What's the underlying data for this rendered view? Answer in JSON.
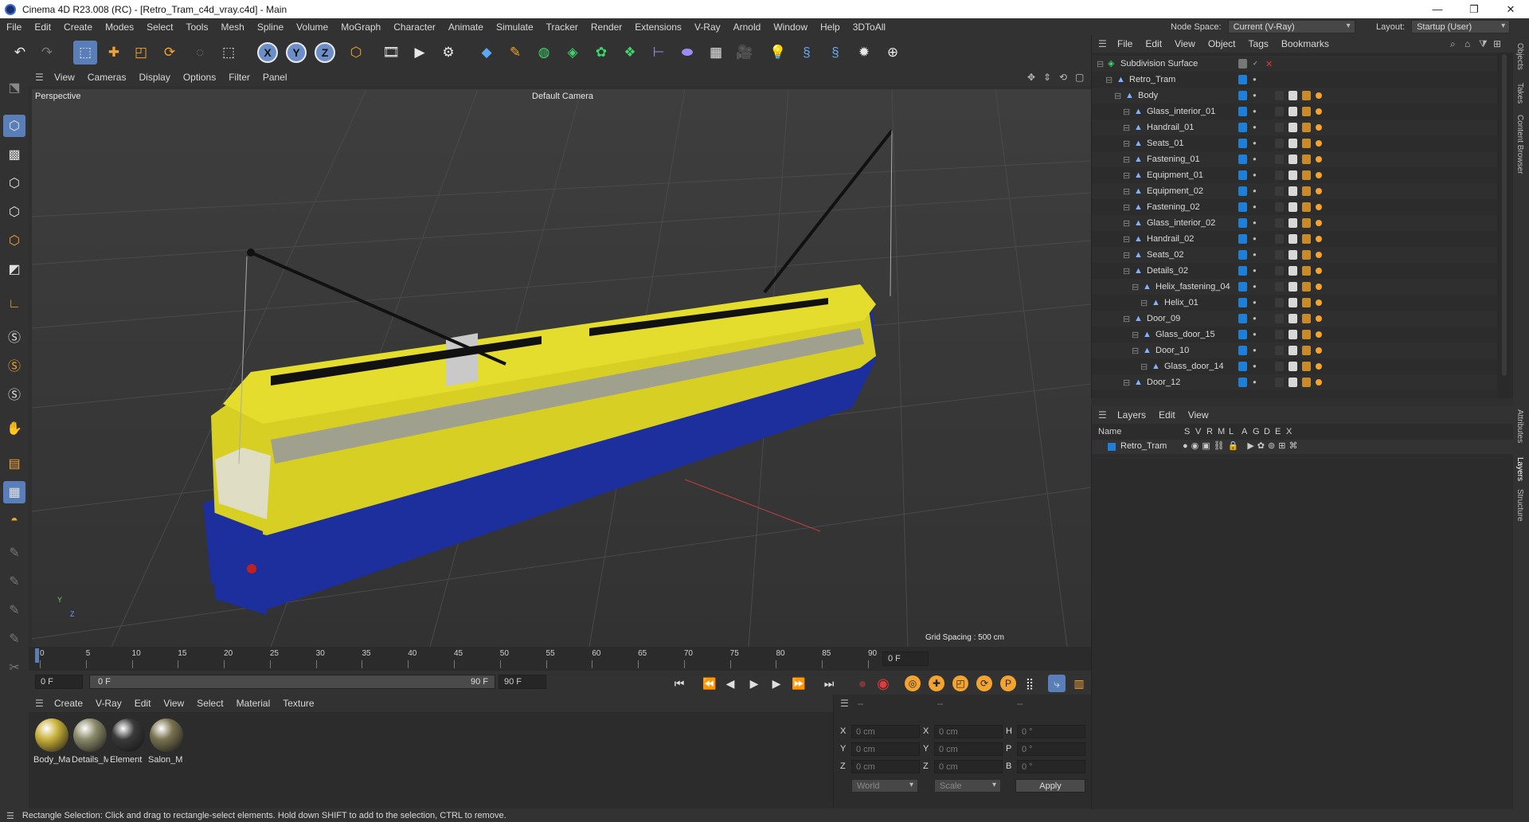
{
  "window": {
    "title": "Cinema 4D R23.008 (RC) - [Retro_Tram_c4d_vray.c4d] - Main",
    "minimize": "—",
    "maximize": "❐",
    "close": "✕"
  },
  "menubar": {
    "items": [
      "File",
      "Edit",
      "Create",
      "Modes",
      "Select",
      "Tools",
      "Mesh",
      "Spline",
      "Volume",
      "MoGraph",
      "Character",
      "Animate",
      "Simulate",
      "Tracker",
      "Render",
      "Extensions",
      "V-Ray",
      "Arnold",
      "Window",
      "Help",
      "3DToAll"
    ],
    "node_space_label": "Node Space:",
    "node_space_value": "Current (V-Ray)",
    "layout_label": "Layout:",
    "layout_value": "Startup (User)"
  },
  "toolbar": {
    "axis_x": "X",
    "axis_y": "Y",
    "axis_z": "Z"
  },
  "viewport": {
    "menu": [
      "View",
      "Cameras",
      "Display",
      "Options",
      "Filter",
      "Panel"
    ],
    "view_name": "Perspective",
    "camera_name": "Default Camera",
    "grid_spacing": "Grid Spacing : 500 cm",
    "axis_y": "Y",
    "axis_z": "Z"
  },
  "timeline": {
    "ticks": [
      "0",
      "5",
      "10",
      "15",
      "20",
      "25",
      "30",
      "35",
      "40",
      "45",
      "50",
      "55",
      "60",
      "65",
      "70",
      "75",
      "80",
      "85",
      "90"
    ],
    "current_frame": "0 F",
    "start_field": "0 F",
    "range_start": "0 F",
    "range_end": "90 F",
    "end_field": "90 F",
    "right_frame": "0 F"
  },
  "materials": {
    "menu": [
      "Create",
      "V-Ray",
      "Edit",
      "View",
      "Select",
      "Material",
      "Texture"
    ],
    "items": [
      {
        "label": "Body_Ma",
        "color": "#c9b13a"
      },
      {
        "label": "Details_M",
        "color": "#8a8a6a"
      },
      {
        "label": "Element",
        "color": "#3a3a3a"
      },
      {
        "label": "Salon_M",
        "color": "#7a7350"
      }
    ]
  },
  "coords": {
    "header_a": "--",
    "header_b": "--",
    "header_c": "--",
    "rows": [
      {
        "l1": "X",
        "v1": "0 cm",
        "l2": "X",
        "v2": "0 cm",
        "l3": "H",
        "v3": "0 °"
      },
      {
        "l1": "Y",
        "v1": "0 cm",
        "l2": "Y",
        "v2": "0 cm",
        "l3": "P",
        "v3": "0 °"
      },
      {
        "l1": "Z",
        "v1": "0 cm",
        "l2": "Z",
        "v2": "0 cm",
        "l3": "B",
        "v3": "0 °"
      }
    ],
    "mode_world": "World",
    "mode_scale": "Scale",
    "apply": "Apply"
  },
  "objects": {
    "menu": [
      "File",
      "Edit",
      "View",
      "Object",
      "Tags",
      "Bookmarks"
    ],
    "rows": [
      {
        "name": "Subdivision Surface",
        "indent": 0
      },
      {
        "name": "Retro_Tram",
        "indent": 1
      },
      {
        "name": "Body",
        "indent": 2
      },
      {
        "name": "Glass_interior_01",
        "indent": 3
      },
      {
        "name": "Handrail_01",
        "indent": 3
      },
      {
        "name": "Seats_01",
        "indent": 3
      },
      {
        "name": "Fastening_01",
        "indent": 3
      },
      {
        "name": "Equipment_01",
        "indent": 3
      },
      {
        "name": "Equipment_02",
        "indent": 3
      },
      {
        "name": "Fastening_02",
        "indent": 3
      },
      {
        "name": "Glass_interior_02",
        "indent": 3
      },
      {
        "name": "Handrail_02",
        "indent": 3
      },
      {
        "name": "Seats_02",
        "indent": 3
      },
      {
        "name": "Details_02",
        "indent": 3
      },
      {
        "name": "Helix_fastening_04",
        "indent": 4
      },
      {
        "name": "Helix_01",
        "indent": 5
      },
      {
        "name": "Door_09",
        "indent": 3
      },
      {
        "name": "Glass_door_15",
        "indent": 4
      },
      {
        "name": "Door_10",
        "indent": 4
      },
      {
        "name": "Glass_door_14",
        "indent": 5
      },
      {
        "name": "Door_12",
        "indent": 3
      }
    ]
  },
  "layers": {
    "menu": [
      "Layers",
      "Edit",
      "View"
    ],
    "columns": [
      "Name",
      "S",
      "V",
      "R",
      "M",
      "L",
      "A",
      "G",
      "D",
      "E",
      "X"
    ],
    "items": [
      {
        "name": "Retro_Tram",
        "color": "#1f7fd6"
      }
    ]
  },
  "side_tabs": [
    "Objects",
    "Takes",
    "Content Browser",
    "Attributes",
    "Layers",
    "Structure"
  ],
  "status": "Rectangle Selection: Click and drag to rectangle-select elements. Hold down SHIFT to add to the selection, CTRL to remove."
}
